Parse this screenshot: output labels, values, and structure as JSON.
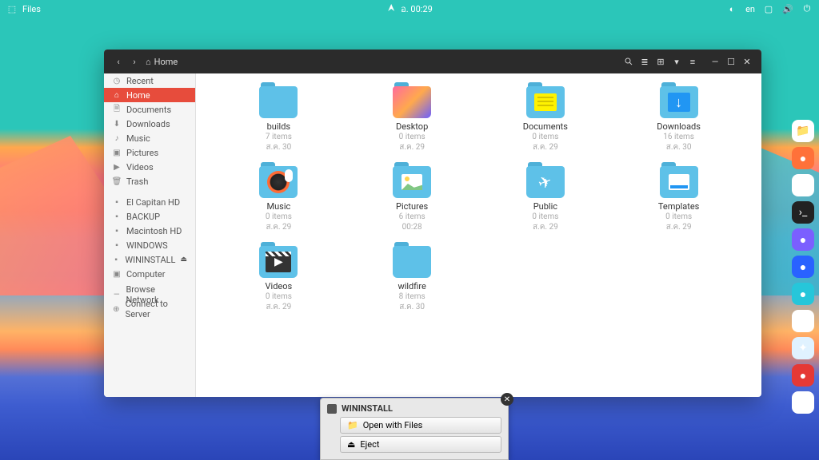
{
  "panel": {
    "app_label": "Files",
    "clock": "อ. 00:29",
    "lang": "en"
  },
  "window": {
    "breadcrumb": "Home"
  },
  "sidebar": {
    "items": [
      {
        "icon": "clock",
        "label": "Recent"
      },
      {
        "icon": "home",
        "label": "Home"
      },
      {
        "icon": "doc",
        "label": "Documents"
      },
      {
        "icon": "down",
        "label": "Downloads"
      },
      {
        "icon": "music",
        "label": "Music"
      },
      {
        "icon": "pic",
        "label": "Pictures"
      },
      {
        "icon": "vid",
        "label": "Videos"
      },
      {
        "icon": "trash",
        "label": "Trash"
      }
    ],
    "drives": [
      {
        "label": "El Capitan HD"
      },
      {
        "label": "BACKUP"
      },
      {
        "label": "Macintosh HD"
      },
      {
        "label": "WINDOWS"
      },
      {
        "label": "WININSTALL",
        "eject": true
      }
    ],
    "computer": "Computer",
    "network": "Browse Network",
    "connect": "Connect to Server"
  },
  "folders": [
    {
      "name": "builds",
      "meta1": "7 items",
      "meta2": "ส.ค. 30",
      "type": "blue"
    },
    {
      "name": "Desktop",
      "meta1": "0 items",
      "meta2": "ส.ค. 29",
      "type": "img"
    },
    {
      "name": "Documents",
      "meta1": "0 items",
      "meta2": "ส.ค. 29",
      "type": "doc",
      "overlay": "doc"
    },
    {
      "name": "Downloads",
      "meta1": "16 items",
      "meta2": "ส.ค. 30",
      "type": "doc",
      "overlay": "dl"
    },
    {
      "name": "Music",
      "meta1": "0 items",
      "meta2": "ส.ค. 29",
      "type": "doc",
      "overlay": "music"
    },
    {
      "name": "Pictures",
      "meta1": "6 items",
      "meta2": "00:28",
      "type": "doc",
      "overlay": "pic"
    },
    {
      "name": "Public",
      "meta1": "0 items",
      "meta2": "ส.ค. 29",
      "type": "doc",
      "overlay": "send"
    },
    {
      "name": "Templates",
      "meta1": "0 items",
      "meta2": "ส.ค. 29",
      "type": "doc",
      "overlay": "tpl"
    },
    {
      "name": "Videos",
      "meta1": "0 items",
      "meta2": "ส.ค. 29",
      "type": "doc",
      "overlay": "vid"
    },
    {
      "name": "wildfire",
      "meta1": "8 items",
      "meta2": "ส.ค. 30",
      "type": "blue"
    }
  ],
  "notification": {
    "title": "WININSTALL",
    "btn_open": "Open with Files",
    "btn_eject": "Eject"
  },
  "dock": [
    {
      "name": "files",
      "bg": "#fff",
      "fg": "#ff9800",
      "glyph": "📁"
    },
    {
      "name": "firefox",
      "bg": "#ff7139",
      "glyph": "●"
    },
    {
      "name": "chrome",
      "bg": "#fff",
      "glyph": "◉"
    },
    {
      "name": "terminal",
      "bg": "#222",
      "glyph": "›_"
    },
    {
      "name": "app-purple",
      "bg": "#7b5fff",
      "glyph": "●"
    },
    {
      "name": "app-blue",
      "bg": "#2962ff",
      "glyph": "●"
    },
    {
      "name": "app-teal",
      "bg": "#26c6da",
      "glyph": "●"
    },
    {
      "name": "photos",
      "bg": "#fff",
      "glyph": "✿"
    },
    {
      "name": "safari",
      "bg": "#e0f2ff",
      "glyph": "✦"
    },
    {
      "name": "app-red",
      "bg": "#e53935",
      "glyph": "●"
    },
    {
      "name": "chromium",
      "bg": "#fff",
      "glyph": "◉"
    }
  ]
}
